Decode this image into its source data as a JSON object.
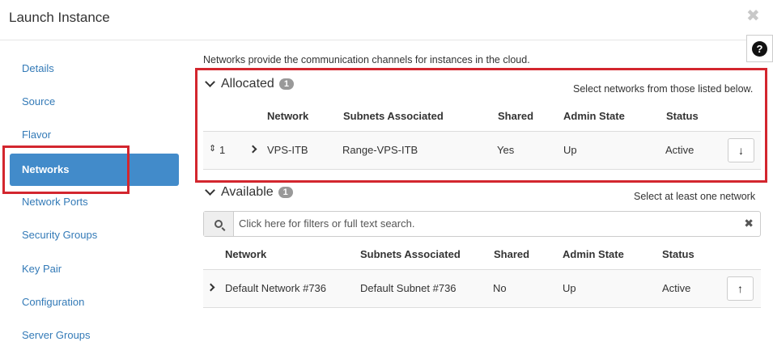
{
  "modal": {
    "title": "Launch Instance",
    "close_glyph": "✖",
    "help_glyph": "?"
  },
  "sidebar": {
    "items": [
      {
        "label": "Details"
      },
      {
        "label": "Source"
      },
      {
        "label": "Flavor"
      },
      {
        "label": "Networks",
        "active": true
      },
      {
        "label": "Network Ports"
      },
      {
        "label": "Security Groups"
      },
      {
        "label": "Key Pair"
      },
      {
        "label": "Configuration"
      },
      {
        "label": "Server Groups"
      }
    ]
  },
  "main": {
    "intro": "Networks provide the communication channels for instances in the cloud.",
    "allocated": {
      "title": "Allocated",
      "count": "1",
      "hint": "Select networks from those listed below.",
      "columns": {
        "network": "Network",
        "subnets": "Subnets Associated",
        "shared": "Shared",
        "admin_state": "Admin State",
        "status": "Status"
      },
      "rows": [
        {
          "order": "1",
          "network": "VPS-ITB",
          "subnets": "Range-VPS-ITB",
          "shared": "Yes",
          "admin_state": "Up",
          "status": "Active",
          "action_glyph": "↓"
        }
      ]
    },
    "available": {
      "title": "Available",
      "count": "1",
      "hint": "Select at least one network",
      "search_placeholder": "Click here for filters or full text search.",
      "clear_glyph": "✖",
      "columns": {
        "network": "Network",
        "subnets": "Subnets Associated",
        "shared": "Shared",
        "admin_state": "Admin State",
        "status": "Status"
      },
      "rows": [
        {
          "network": "Default Network #736",
          "subnets": "Default Subnet #736",
          "shared": "No",
          "admin_state": "Up",
          "status": "Active",
          "action_glyph": "↑"
        }
      ]
    }
  },
  "colors": {
    "accent": "#428bca",
    "link": "#337ab7",
    "highlight_box": "#d3262e",
    "badge": "#999999"
  }
}
